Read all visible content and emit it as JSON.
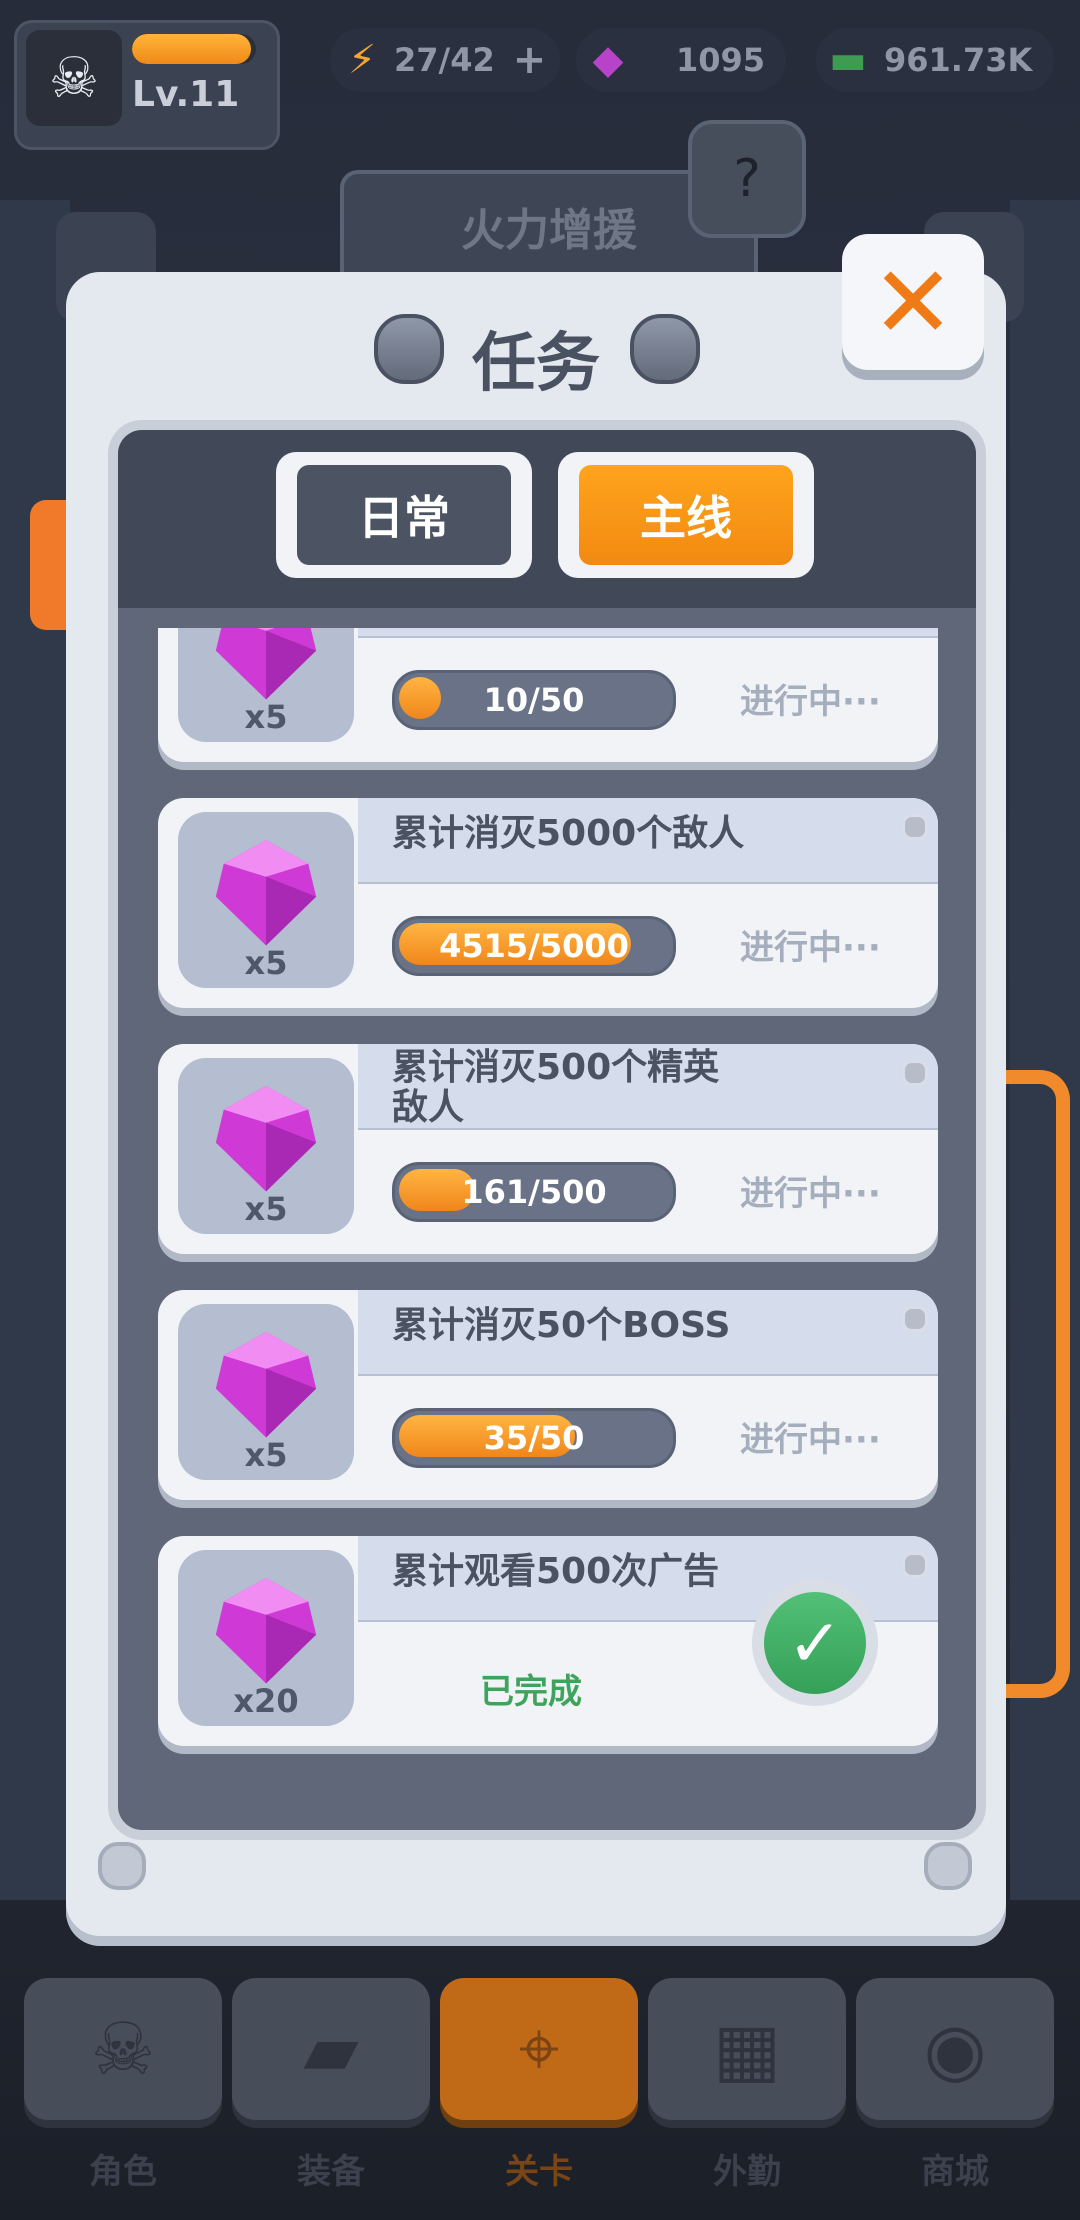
{
  "hud": {
    "level": "Lv.11",
    "energy": "27/42",
    "gems": "1095",
    "cash": "961.73K",
    "plus": "+"
  },
  "event": {
    "title": "火力增援",
    "help": "?"
  },
  "modal": {
    "title": "任务",
    "close": "✕",
    "tabs": [
      {
        "label": "日常",
        "active": false
      },
      {
        "label": "主线",
        "active": true
      }
    ],
    "tasks": [
      {
        "title": "",
        "reward_qty": "x5",
        "progress_text": "10/50",
        "progress": 0.2,
        "status": "进行中···",
        "completed": false
      },
      {
        "title": "累计消灭5000个敌人",
        "reward_qty": "x5",
        "progress_text": "4515/5000",
        "progress": 0.903,
        "status": "进行中···",
        "completed": false
      },
      {
        "title": "累计消灭500个精英敌人",
        "reward_qty": "x5",
        "progress_text": "161/500",
        "progress": 0.322,
        "status": "进行中···",
        "completed": false
      },
      {
        "title": "累计消灭50个BOSS",
        "reward_qty": "x5",
        "progress_text": "35/50",
        "progress": 0.7,
        "status": "进行中···",
        "completed": false
      },
      {
        "title": "累计观看500次广告",
        "reward_qty": "x20",
        "progress_text": "",
        "progress": 1,
        "status": "已完成",
        "completed": true
      }
    ]
  },
  "nav": {
    "items": [
      {
        "label": "角色",
        "icon": "skull-icon"
      },
      {
        "label": "装备",
        "icon": "gun-icon"
      },
      {
        "label": "关卡",
        "icon": "map-pin-icon",
        "active": true
      },
      {
        "label": "外勤",
        "icon": "grid-icon"
      },
      {
        "label": "商城",
        "icon": "shop-icon"
      }
    ]
  },
  "colors": {
    "accent": "#f08a1b",
    "done": "#3fa35c",
    "gem": "#d63fd9"
  }
}
